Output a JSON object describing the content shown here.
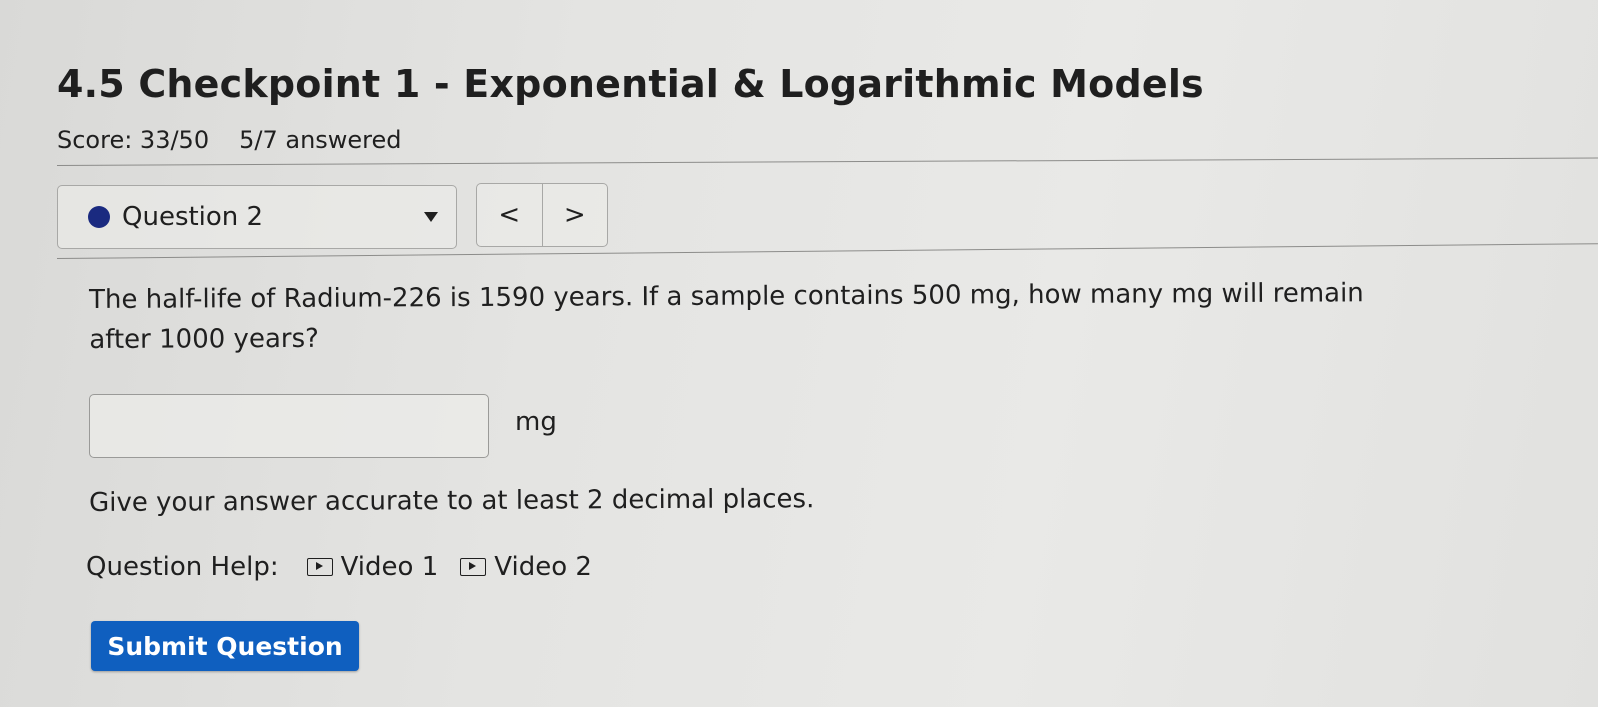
{
  "header": {
    "title": "4.5 Checkpoint 1 - Exponential & Logarithmic Models",
    "score": "Score: 33/50",
    "answered": "5/7 answered"
  },
  "question_nav": {
    "selected": "Question 2",
    "prev_symbol": "<",
    "next_symbol": ">"
  },
  "question": {
    "text": "The half-life of Radium-226 is 1590 years. If a sample contains 500 mg, how many mg will remain after 1000 years?",
    "answer_value": "",
    "unit": "mg",
    "instruction": "Give your answer accurate to at least 2 decimal places."
  },
  "help": {
    "label": "Question Help:",
    "videos": [
      {
        "label": "Video 1",
        "icon": "video-icon"
      },
      {
        "label": "Video 2",
        "icon": "video-icon"
      }
    ]
  },
  "submit": {
    "label": "Submit Question"
  },
  "colors": {
    "status_dot": "#1a2a80",
    "submit_bg": "#0f5fbf"
  }
}
